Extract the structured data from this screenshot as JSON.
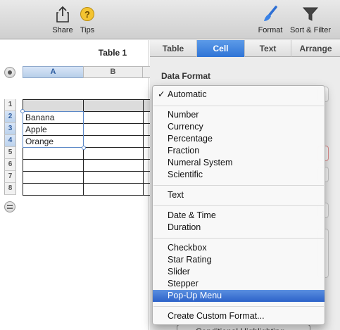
{
  "toolbar": {
    "share_label": "Share",
    "tips_label": "Tips",
    "format_label": "Format",
    "sort_filter_label": "Sort & Filter"
  },
  "sheet": {
    "columns": [
      "A",
      "B"
    ],
    "table_title": "Table 1",
    "row_numbers": [
      "1",
      "2",
      "3",
      "4",
      "5",
      "6",
      "7",
      "8"
    ],
    "cells": [
      "Banana",
      "Apple",
      "Orange"
    ]
  },
  "inspector": {
    "tabs": [
      "Table",
      "Cell",
      "Text",
      "Arrange"
    ],
    "active_tab": "Cell",
    "data_format_label": "Data Format",
    "conditional_button": "Conditional Highlighting..."
  },
  "menu": {
    "selected": "Automatic",
    "highlighted": "Pop-Up Menu",
    "check_glyph": "✓",
    "groups": [
      [
        "Automatic"
      ],
      [
        "Number",
        "Currency",
        "Percentage",
        "Fraction",
        "Numeral System",
        "Scientific"
      ],
      [
        "Text"
      ],
      [
        "Date & Time",
        "Duration"
      ],
      [
        "Checkbox",
        "Star Rating",
        "Slider",
        "Stepper",
        "Pop-Up Menu"
      ],
      [
        "Create Custom Format..."
      ]
    ]
  },
  "colors": {
    "accent": "#2f74d6",
    "menu_highlight": "#3a6fd4"
  }
}
